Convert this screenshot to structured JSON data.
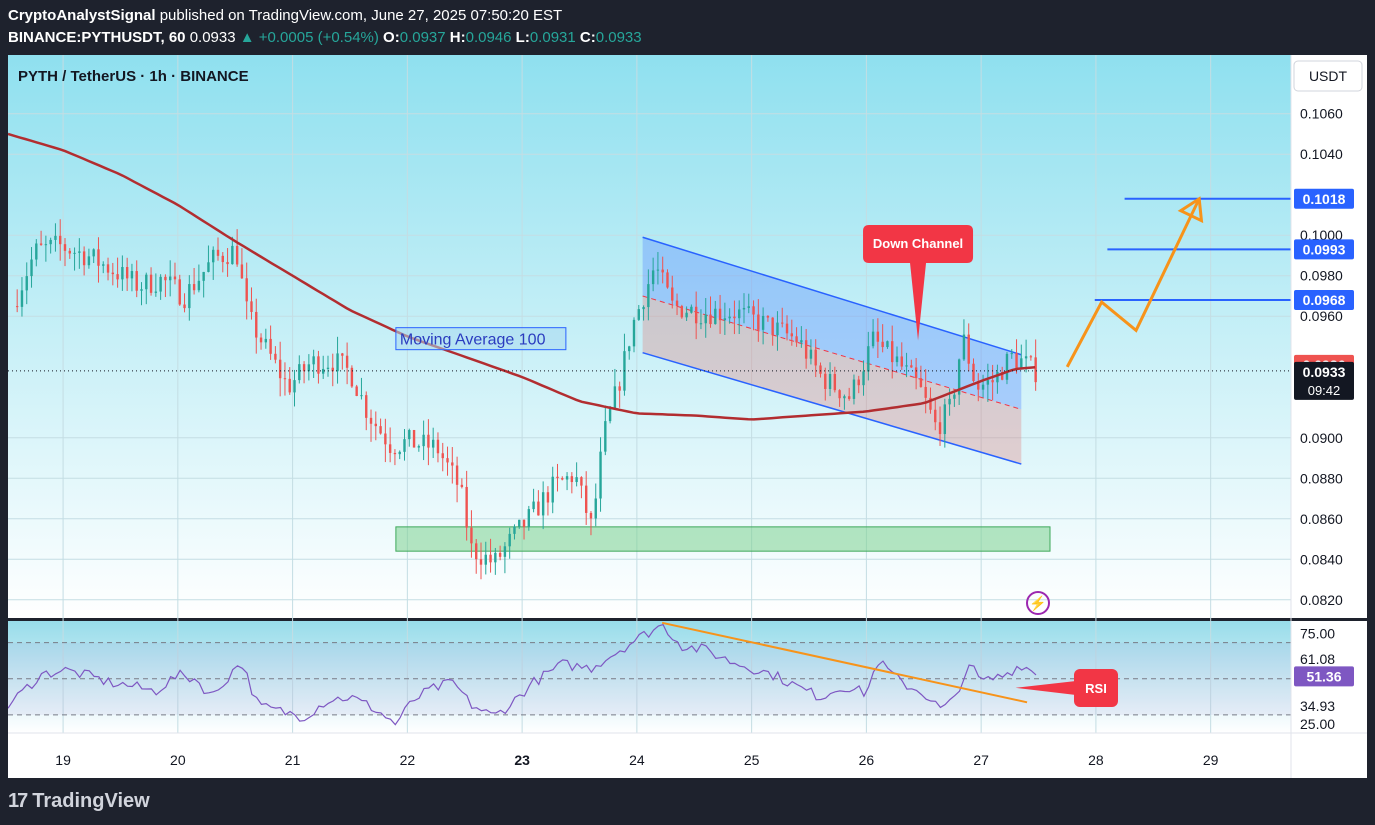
{
  "header": {
    "author": "CryptoAnalystSignal",
    "published_text": "published on TradingView.com, June 27, 2025 07:50:20 EST",
    "symbol": "BINANCE:PYTHUSDT, 60",
    "last": "0.0933",
    "change": "▲ +0.0005 (+0.54%)",
    "o_label": "O:",
    "o_value": "0.0937",
    "h_label": "H:",
    "h_value": "0.0946",
    "l_label": "L:",
    "l_value": "0.0931",
    "c_label": "C:",
    "c_value": "0.0933"
  },
  "chart_title": "PYTH / TetherUS · 1h · BINANCE",
  "currency_button": "USDT",
  "footer_brand": "TradingView",
  "colors": {
    "up": "#26a69a",
    "down": "#ef5350",
    "ma": "#b22d30",
    "channel_line": "#2962ff",
    "orange": "#f7931a",
    "rsi": "#7e57c2",
    "callout": "#f23645"
  },
  "chart_data": {
    "type": "candlestick",
    "x_tick_labels": [
      "19",
      "20",
      "21",
      "22",
      "23",
      "24",
      "25",
      "26",
      "27",
      "28",
      "29"
    ],
    "x_range_days": [
      18.52,
      29.7
    ],
    "y_tick_labels": [
      "0.1060",
      "0.1040",
      "0.1000",
      "0.0980",
      "0.0960",
      "0.0900",
      "0.0880",
      "0.0860",
      "0.0840",
      "0.0820"
    ],
    "ylim": [
      0.0811,
      0.1089
    ],
    "ohlc_anchors": [
      [
        18.6,
        0.0965
      ],
      [
        18.8,
        0.0992
      ],
      [
        19.0,
        0.0995
      ],
      [
        19.25,
        0.099
      ],
      [
        19.5,
        0.0982
      ],
      [
        19.7,
        0.0975
      ],
      [
        19.9,
        0.0978
      ],
      [
        20.1,
        0.097
      ],
      [
        20.35,
        0.0988
      ],
      [
        20.55,
        0.0993
      ],
      [
        20.65,
        0.096
      ],
      [
        20.85,
        0.094
      ],
      [
        21.0,
        0.0925
      ],
      [
        21.2,
        0.0937
      ],
      [
        21.4,
        0.0938
      ],
      [
        21.55,
        0.0932
      ],
      [
        21.7,
        0.0912
      ],
      [
        21.9,
        0.0896
      ],
      [
        22.05,
        0.0898
      ],
      [
        22.3,
        0.0895
      ],
      [
        22.5,
        0.0875
      ],
      [
        22.6,
        0.0845
      ],
      [
        22.8,
        0.0838
      ],
      [
        22.95,
        0.085
      ],
      [
        23.1,
        0.086
      ],
      [
        23.3,
        0.0875
      ],
      [
        23.5,
        0.0882
      ],
      [
        23.65,
        0.0855
      ],
      [
        23.75,
        0.09
      ],
      [
        23.9,
        0.093
      ],
      [
        24.0,
        0.0955
      ],
      [
        24.2,
        0.0985
      ],
      [
        24.35,
        0.0965
      ],
      [
        24.6,
        0.0962
      ],
      [
        24.9,
        0.0962
      ],
      [
        25.2,
        0.0955
      ],
      [
        25.45,
        0.0948
      ],
      [
        25.65,
        0.093
      ],
      [
        25.9,
        0.092
      ],
      [
        26.1,
        0.0948
      ],
      [
        26.3,
        0.0938
      ],
      [
        26.5,
        0.0925
      ],
      [
        26.65,
        0.0905
      ],
      [
        26.78,
        0.0915
      ],
      [
        26.88,
        0.095
      ],
      [
        27.0,
        0.0925
      ],
      [
        27.15,
        0.0928
      ],
      [
        27.3,
        0.094
      ],
      [
        27.42,
        0.0937
      ],
      [
        27.5,
        0.0933
      ]
    ],
    "ma100_label": "Moving Average 100",
    "ma100": [
      [
        18.52,
        0.105
      ],
      [
        19.0,
        0.1042
      ],
      [
        19.5,
        0.103
      ],
      [
        20.0,
        0.1015
      ],
      [
        20.5,
        0.0997
      ],
      [
        21.0,
        0.098
      ],
      [
        21.5,
        0.0963
      ],
      [
        22.0,
        0.095
      ],
      [
        22.5,
        0.094
      ],
      [
        23.0,
        0.093
      ],
      [
        23.5,
        0.0918
      ],
      [
        24.0,
        0.0912
      ],
      [
        24.5,
        0.0911
      ],
      [
        25.0,
        0.0909
      ],
      [
        25.5,
        0.0911
      ],
      [
        26.0,
        0.0913
      ],
      [
        26.5,
        0.0917
      ],
      [
        27.0,
        0.0928
      ],
      [
        27.3,
        0.0934
      ],
      [
        27.5,
        0.0935
      ]
    ],
    "down_channel": {
      "label": "Down Channel",
      "upper": [
        [
          24.05,
          0.0999
        ],
        [
          27.35,
          0.0941
        ]
      ],
      "lower": [
        [
          24.05,
          0.0942
        ],
        [
          27.35,
          0.0887
        ]
      ],
      "mid": [
        [
          24.05,
          0.097
        ],
        [
          27.35,
          0.0914
        ]
      ]
    },
    "support_zone": {
      "x": [
        21.9,
        27.6
      ],
      "y": [
        0.0844,
        0.0856
      ]
    },
    "levels": [
      {
        "value": "0.1018",
        "y": 0.1018,
        "x_start": 28.25
      },
      {
        "value": "0.0993",
        "y": 0.0993,
        "x_start": 28.1
      },
      {
        "value": "0.0968",
        "y": 0.0968,
        "x_start": 27.99
      }
    ],
    "projection": [
      [
        27.75,
        0.0935
      ],
      [
        28.05,
        0.0967
      ],
      [
        28.35,
        0.0953
      ],
      [
        28.9,
        0.1018
      ]
    ],
    "price_badges": {
      "prev_close": "0.0936",
      "last": "0.0933",
      "countdown": "09:42"
    },
    "rsi": {
      "label": "RSI",
      "tick_labels": [
        "75.00",
        "61.08",
        "51.36",
        "34.93",
        "25.00"
      ],
      "ylim": [
        20,
        82
      ],
      "levels": [
        70,
        50,
        30
      ],
      "current": "51.36",
      "anchors": [
        [
          18.52,
          35
        ],
        [
          18.8,
          52
        ],
        [
          19.0,
          55
        ],
        [
          19.2,
          52
        ],
        [
          19.4,
          48
        ],
        [
          19.6,
          46
        ],
        [
          19.8,
          43
        ],
        [
          20.0,
          52
        ],
        [
          20.15,
          50
        ],
        [
          20.3,
          40
        ],
        [
          20.55,
          60
        ],
        [
          20.7,
          35
        ],
        [
          20.9,
          32
        ],
        [
          21.1,
          29
        ],
        [
          21.3,
          38
        ],
        [
          21.5,
          40
        ],
        [
          21.7,
          34
        ],
        [
          21.9,
          25
        ],
        [
          22.05,
          38
        ],
        [
          22.2,
          44
        ],
        [
          22.4,
          48
        ],
        [
          22.55,
          36
        ],
        [
          22.75,
          29
        ],
        [
          22.9,
          36
        ],
        [
          23.1,
          48
        ],
        [
          23.35,
          58
        ],
        [
          23.6,
          56
        ],
        [
          23.8,
          64
        ],
        [
          24.0,
          72
        ],
        [
          24.22,
          80
        ],
        [
          24.4,
          68
        ],
        [
          24.6,
          66
        ],
        [
          24.8,
          60
        ],
        [
          25.0,
          56
        ],
        [
          25.2,
          52
        ],
        [
          25.45,
          44
        ],
        [
          25.6,
          40
        ],
        [
          25.8,
          46
        ],
        [
          26.0,
          42
        ],
        [
          26.1,
          60
        ],
        [
          26.3,
          48
        ],
        [
          26.5,
          42
        ],
        [
          26.65,
          33
        ],
        [
          26.8,
          40
        ],
        [
          26.88,
          60
        ],
        [
          27.0,
          48
        ],
        [
          27.2,
          52
        ],
        [
          27.35,
          58
        ],
        [
          27.5,
          52
        ]
      ],
      "trendline": [
        [
          24.22,
          81
        ],
        [
          27.4,
          37
        ]
      ]
    },
    "annotation_arrow_to": [
      27.3,
      45
    ]
  }
}
